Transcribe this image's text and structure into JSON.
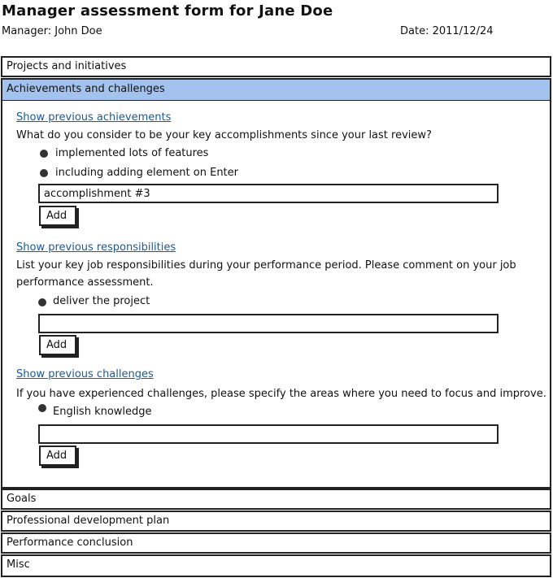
{
  "header": {
    "title": "Manager assessment form for Jane Doe",
    "manager": "Manager: John Doe",
    "date": "Date: 2011/12/24"
  },
  "accordion": {
    "projects": "Projects and initiatives",
    "achievements": "Achievements and challenges",
    "goals": "Goals",
    "development": "Professional development plan",
    "conclusion": "Performance conclusion",
    "misc": "Misc"
  },
  "achievements": {
    "show_link": "Show previous achievements",
    "question": "What do you consider to be your key accomplishments since your last review?",
    "items": [
      "implemented lots of features",
      "including adding element on Enter"
    ],
    "input_value": "accomplishment #3",
    "add_label": "Add"
  },
  "responsibilities": {
    "show_link": "Show previous responsibilities",
    "question_line1": "List your key job responsibilities during your performance period. Please comment on your job",
    "question_line2": "performance assessment.",
    "items": [
      "deliver the project"
    ],
    "input_value": "",
    "add_label": "Add"
  },
  "challenges": {
    "show_link": "Show previous challenges",
    "question": "If you have experienced challenges, please specify the areas where you need to focus and improve.",
    "items": [
      "English knowledge"
    ],
    "input_value": "",
    "add_label": "Add"
  },
  "colors": {
    "active_header": "#a3c3ee",
    "link": "#1a5a9a"
  }
}
